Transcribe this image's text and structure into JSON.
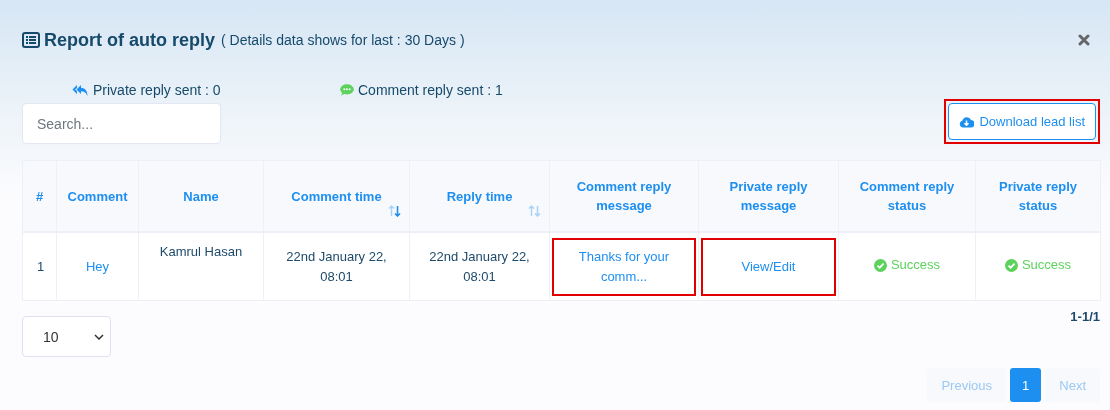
{
  "header": {
    "title": "Report of auto reply",
    "subtitle": "( Details data shows for last : 30 Days )"
  },
  "stats": [
    {
      "kind": "private",
      "label": "Private reply sent : 0"
    },
    {
      "kind": "comment",
      "label": "Comment reply sent : 1"
    }
  ],
  "search": {
    "placeholder": "Search..."
  },
  "download_button": {
    "label": "Download lead list",
    "highlighted": true
  },
  "table": {
    "columns": [
      {
        "label": "#"
      },
      {
        "label": "Comment"
      },
      {
        "label": "Name"
      },
      {
        "label": "Comment time",
        "sortable": true,
        "sorted": true
      },
      {
        "label": "Reply time",
        "sortable": true,
        "sorted": false
      },
      {
        "label": "Comment reply message"
      },
      {
        "label": "Private reply message"
      },
      {
        "label": "Comment reply status"
      },
      {
        "label": "Private reply status"
      }
    ],
    "rows": [
      {
        "cells": [
          {
            "kind": "text",
            "text": "1"
          },
          {
            "kind": "link",
            "text": "Hey",
            "highlighted": false
          },
          {
            "kind": "name",
            "text": "Kamrul Hasan"
          },
          {
            "kind": "text",
            "text": "22nd January 22, 08:01"
          },
          {
            "kind": "text",
            "text": "22nd January 22, 08:01"
          },
          {
            "kind": "link",
            "text": "Thanks for your comm...",
            "highlighted": true
          },
          {
            "kind": "link",
            "text": "View/Edit",
            "highlighted": true
          },
          {
            "kind": "status",
            "text": "Success",
            "color": "#5cd25c"
          },
          {
            "kind": "status",
            "text": "Success",
            "color": "#5cd25c"
          }
        ]
      }
    ]
  },
  "page_size": {
    "value": "10"
  },
  "range": "1-1/1",
  "pagination": [
    {
      "kind": "nav",
      "label": "Previous",
      "disabled": true,
      "selected": false
    },
    {
      "kind": "page",
      "label": "1",
      "disabled": false,
      "selected": true
    },
    {
      "kind": "nav",
      "label": "Next",
      "disabled": true,
      "selected": false
    }
  ]
}
